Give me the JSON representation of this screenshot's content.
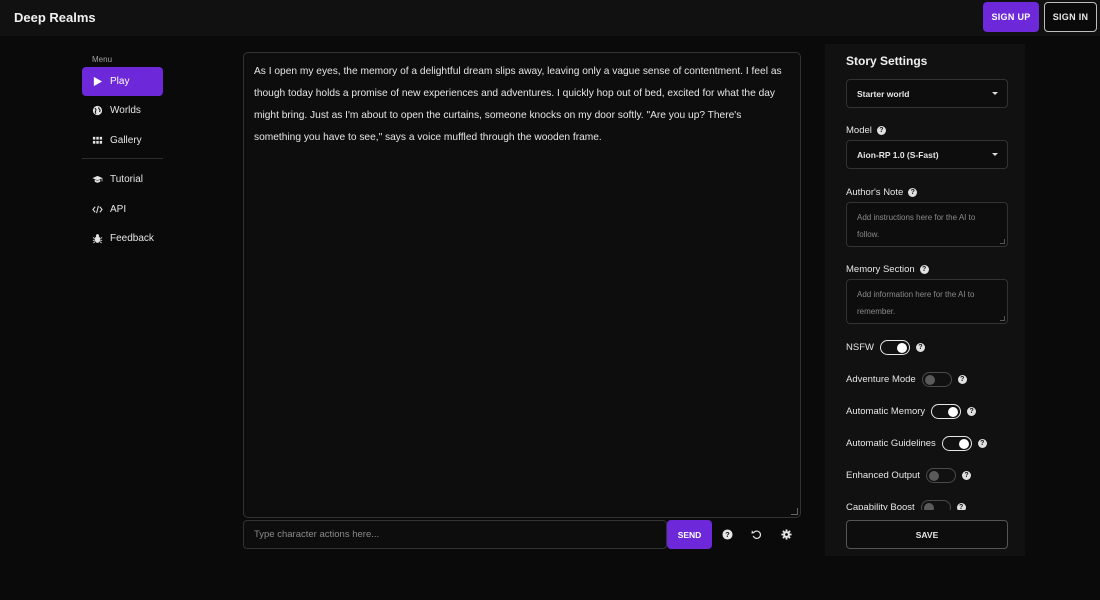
{
  "app": {
    "title": "Deep Realms"
  },
  "header": {
    "signup_label": "SIGN UP",
    "signin_label": "SIGN IN"
  },
  "sidebar": {
    "menu_label": "Menu",
    "items": [
      {
        "label": "Play",
        "icon": "play-icon",
        "active": true
      },
      {
        "label": "Worlds",
        "icon": "globe-icon"
      },
      {
        "label": "Gallery",
        "icon": "grid-icon"
      },
      {
        "label": "Tutorial",
        "icon": "graduation-cap-icon"
      },
      {
        "label": "API",
        "icon": "code-icon"
      },
      {
        "label": "Feedback",
        "icon": "bug-icon"
      }
    ]
  },
  "story": {
    "text": "As I open my eyes, the memory of a delightful dream slips away, leaving only a vague sense of contentment. I feel as though today holds a promise of new experiences and adventures. I quickly hop out of bed, excited for what the day might bring. Just as I'm about to open the curtains, someone knocks on my door softly. \"Are you up? There's something you have to see,\" says a voice muffled through the wooden frame."
  },
  "action": {
    "placeholder": "Type character actions here...",
    "send_label": "SEND",
    "tools": [
      "help-icon",
      "undo-icon",
      "settings-icon"
    ]
  },
  "settings": {
    "title": "Story Settings",
    "world_select": "Starter world",
    "model_label": "Model",
    "model_select": "Aion-RP 1.0 (S-Fast)",
    "authors_note_label": "Author's Note",
    "authors_note_placeholder": "Add instructions here for the AI to follow.",
    "memory_label": "Memory Section",
    "memory_placeholder": "Add information here for the AI to remember.",
    "toggles": [
      {
        "label": "NSFW",
        "on": true
      },
      {
        "label": "Adventure Mode",
        "on": false
      },
      {
        "label": "Automatic Memory",
        "on": true
      },
      {
        "label": "Automatic Guidelines",
        "on": true
      },
      {
        "label": "Enhanced Output",
        "on": false
      },
      {
        "label": "Capability Boost",
        "on": false
      }
    ],
    "save_label": "SAVE"
  },
  "colors": {
    "accent": "#6d28d9",
    "background": "#0a0a0a",
    "panel": "#111111"
  }
}
